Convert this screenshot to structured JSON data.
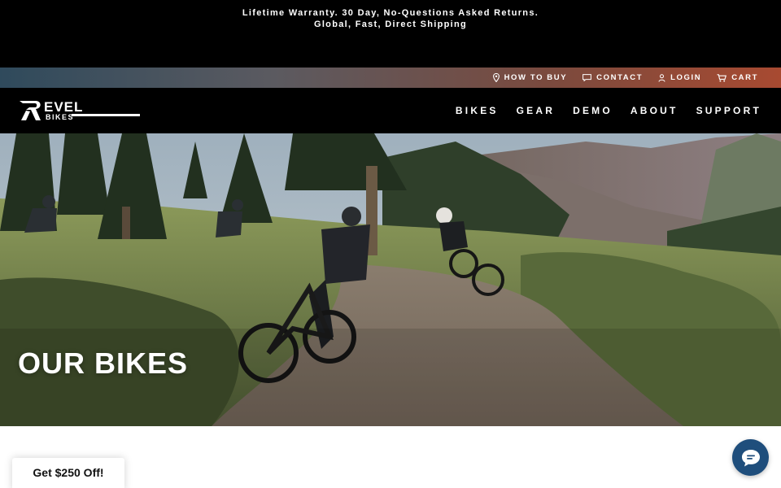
{
  "announcement": {
    "line1": "Lifetime Warranty.  30 Day, No-Questions Asked Returns.",
    "line2": "Global, Fast, Direct Shipping"
  },
  "utility_nav": [
    {
      "label": "HOW TO BUY",
      "icon": "map-pin-icon"
    },
    {
      "label": "CONTACT",
      "icon": "chat-bubble-icon"
    },
    {
      "label": "LOGIN",
      "icon": "user-icon"
    },
    {
      "label": "CART",
      "icon": "cart-icon"
    }
  ],
  "brand": {
    "name": "REVEL",
    "sub": "BIKES"
  },
  "main_nav": [
    "BIKES",
    "GEAR",
    "DEMO",
    "ABOUT",
    "SUPPORT"
  ],
  "hero": {
    "title": "OUR BIKES"
  },
  "promo": {
    "label": "Get $250 Off!"
  },
  "chat": {
    "icon": "chat-icon"
  },
  "colors": {
    "nav_bg": "#000000",
    "chat_bg": "#1f4e7c",
    "utility_gradient_start": "#2f4a5c",
    "utility_gradient_end": "#a84a31"
  }
}
